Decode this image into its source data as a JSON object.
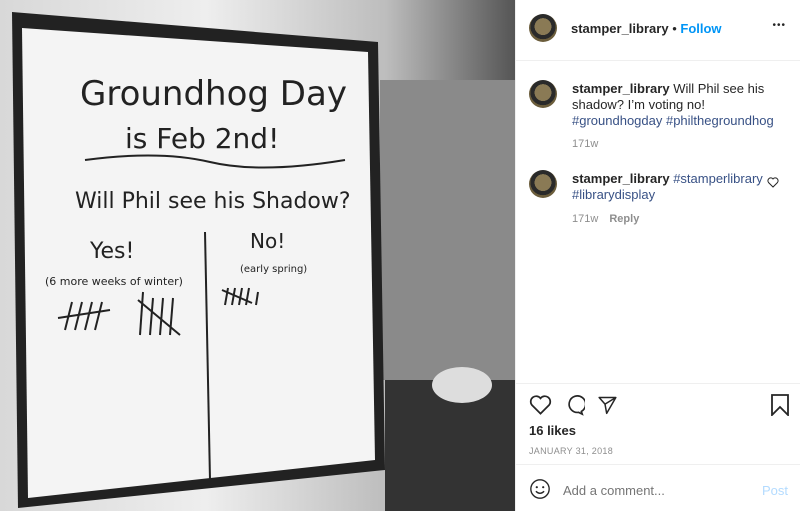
{
  "photo": {
    "board_lines": [
      "Groundhog Day",
      "is Feb 2nd!",
      "Will Phil see his Shadow?"
    ],
    "yes": "Yes!",
    "yes_note": "(6 more weeks of winter)",
    "no": "No!",
    "no_note": "(early spring)"
  },
  "header": {
    "username": "stamper_library",
    "separator": "•",
    "follow": "Follow",
    "more": "•••"
  },
  "comments": [
    {
      "username": "stamper_library",
      "text": "Will Phil see his shadow? I’m voting no!",
      "tags": "#groundhogday #philthegroundhog",
      "time": "171w"
    },
    {
      "username": "stamper_library",
      "tags": "#stamperlibrary #librarydisplay",
      "time": "171w",
      "reply": "Reply"
    }
  ],
  "actions": {
    "likes": "16 likes",
    "date": "JANUARY 31, 2018"
  },
  "comment_box": {
    "placeholder": "Add a comment...",
    "post": "Post"
  }
}
